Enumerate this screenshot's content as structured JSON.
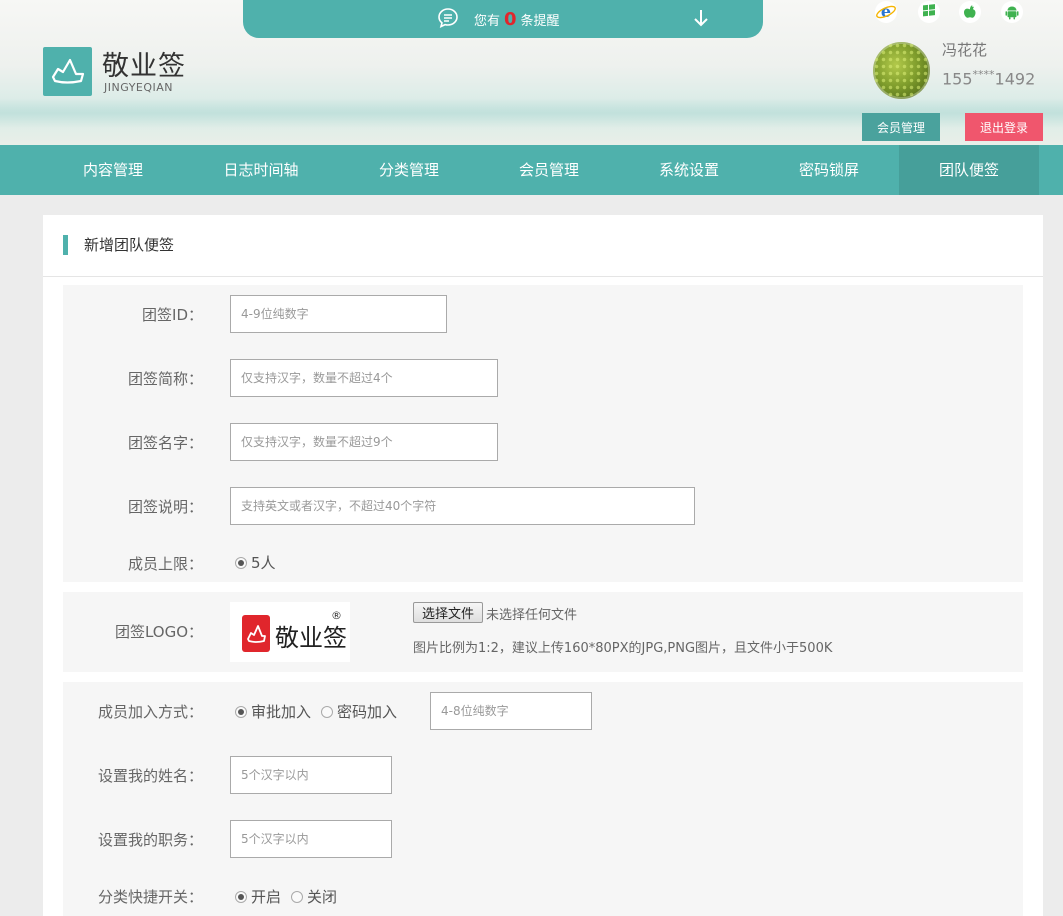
{
  "notice": {
    "prefix": "您有",
    "count": "0",
    "suffix": "条提醒"
  },
  "brand": {
    "name": "敬业签",
    "pinyin": "JINGYEQIAN"
  },
  "platforms": [
    "ie-icon",
    "windows-icon",
    "apple-icon",
    "android-icon"
  ],
  "user": {
    "name": "冯花花",
    "phone_prefix": "155",
    "phone_mask": "****",
    "phone_suffix": "1492"
  },
  "header_buttons": {
    "member": "会员管理",
    "logout": "退出登录"
  },
  "nav": {
    "items": [
      {
        "label": "内容管理"
      },
      {
        "label": "日志时间轴"
      },
      {
        "label": "分类管理"
      },
      {
        "label": "会员管理"
      },
      {
        "label": "系统设置"
      },
      {
        "label": "密码锁屏"
      },
      {
        "label": "团队便签"
      }
    ],
    "active_index": 6
  },
  "page": {
    "title": "新增团队便签"
  },
  "form": {
    "team_id": {
      "label": "团签ID：",
      "placeholder": "4-9位纯数字"
    },
    "short_name": {
      "label": "团签简称：",
      "placeholder": "仅支持汉字，数量不超过4个"
    },
    "full_name": {
      "label": "团签名字：",
      "placeholder": "仅支持汉字，数量不超过9个"
    },
    "description": {
      "label": "团签说明：",
      "placeholder": "支持英文或者汉字，不超过40个字符"
    },
    "member_limit": {
      "label": "成员上限：",
      "option": "5人"
    },
    "logo": {
      "label": "团签LOGO：",
      "preview_text": "敬业签",
      "reg_mark": "®",
      "file_button": "选择文件",
      "file_status": "未选择任何文件",
      "hint": "图片比例为1:2，建议上传160*80PX的JPG,PNG图片，且文件小于500K"
    },
    "join_method": {
      "label": "成员加入方式：",
      "option_approve": "审批加入",
      "option_password": "密码加入",
      "password_placeholder": "4-8位纯数字"
    },
    "my_name": {
      "label": "设置我的姓名：",
      "placeholder": "5个汉字以内"
    },
    "my_title": {
      "label": "设置我的职务：",
      "placeholder": "5个汉字以内"
    },
    "quick_switch": {
      "label": "分类快捷开关：",
      "option_on": "开启",
      "option_off": "关闭"
    }
  },
  "colors": {
    "accent": "#4fb1ac",
    "accent_dark": "#469f9a",
    "danger": "#f0566d",
    "notice_count": "#e0262c"
  }
}
